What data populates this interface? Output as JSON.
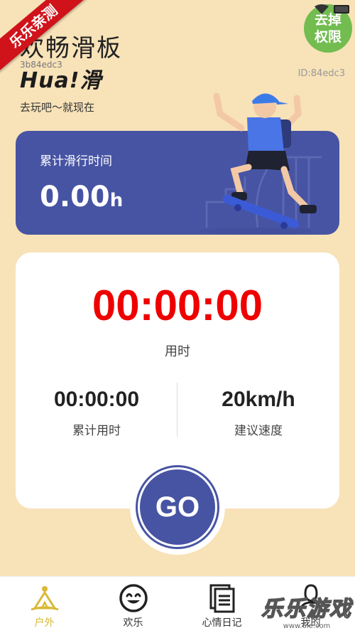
{
  "header": {
    "title": "欢畅滑板",
    "hash_left": "3b84edc3",
    "hash_right": "ID:84edc3",
    "logo_text": "Hua!滑",
    "slogan": "去玩吧～就现在"
  },
  "overlays": {
    "ribbon": "乐乐亲测",
    "perm_line1": "去掉",
    "perm_line2": "权限",
    "watermark_big": "乐乐游戏",
    "watermark_small": "www.6le.com"
  },
  "total_card": {
    "label": "累计滑行时间",
    "value": "0.00",
    "unit": "h"
  },
  "timer": {
    "big_value": "00:00:00",
    "big_label": "用时",
    "stats": [
      {
        "value": "00:00:00",
        "label": "累计用时"
      },
      {
        "value": "20km/h",
        "label": "建议速度"
      }
    ]
  },
  "go_label": "GO",
  "tabs": [
    {
      "label": "户外",
      "icon": "camp-icon",
      "active": true
    },
    {
      "label": "欢乐",
      "icon": "smile-icon",
      "active": false
    },
    {
      "label": "心情日记",
      "icon": "diary-icon",
      "active": false
    },
    {
      "label": "我的",
      "icon": "profile-icon",
      "active": false
    }
  ],
  "colors": {
    "background": "#f8e2b8",
    "card_blue": "#4754a3",
    "timer_red": "#ee0000",
    "tab_active": "#d9b935"
  }
}
